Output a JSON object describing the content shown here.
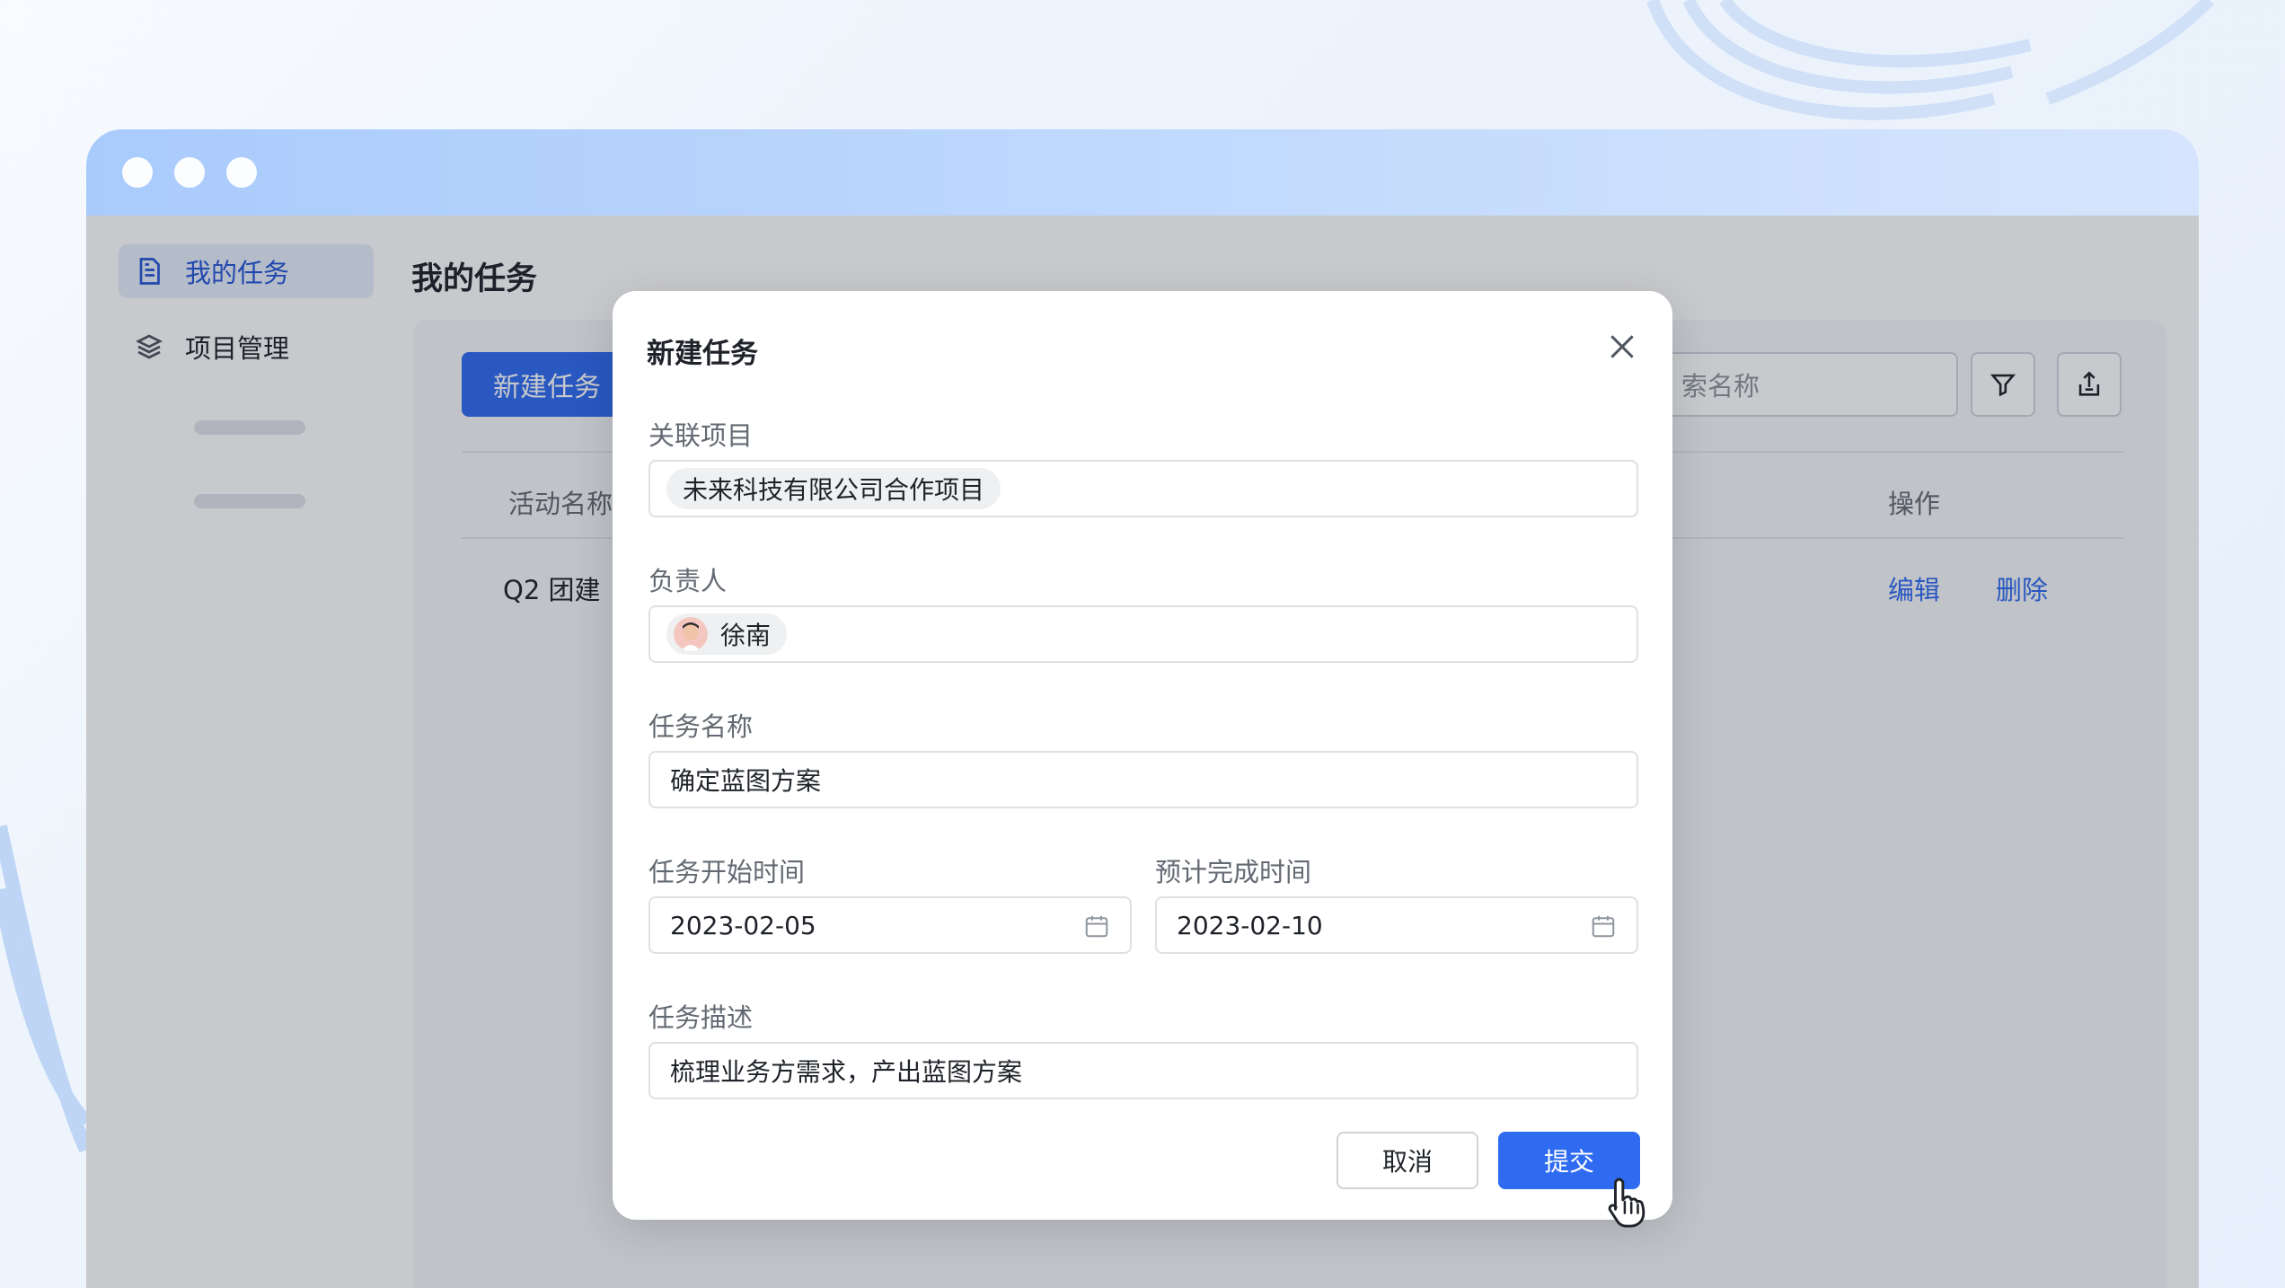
{
  "window": {
    "traffic_lights": [
      "dot",
      "dot",
      "dot"
    ]
  },
  "sidebar": {
    "items": [
      {
        "label": "我的任务",
        "icon": "document-icon",
        "active": true
      },
      {
        "label": "项目管理",
        "icon": "layers-icon",
        "active": false
      }
    ]
  },
  "page": {
    "title": "我的任务"
  },
  "toolbar": {
    "new_task_label": "新建任务",
    "search_placeholder": "搜索名称",
    "search_visible_text": "索名称",
    "filter_icon": "filter-icon",
    "export_icon": "export-icon"
  },
  "table": {
    "headers": {
      "name": "活动名称",
      "actions": "操作"
    },
    "rows": [
      {
        "name": "Q2 团建",
        "edit": "编辑",
        "delete": "删除"
      }
    ]
  },
  "modal": {
    "title": "新建任务",
    "close_icon": "close-icon",
    "project": {
      "label": "关联项目",
      "value": "未来科技有限公司合作项目"
    },
    "owner": {
      "label": "负责人",
      "value": "徐南"
    },
    "task_name": {
      "label": "任务名称",
      "value": "确定蓝图方案"
    },
    "start_date": {
      "label": "任务开始时间",
      "value": "2023-02-05"
    },
    "end_date": {
      "label": "预计完成时间",
      "value": "2023-02-10"
    },
    "description": {
      "label": "任务描述",
      "value": "梳理业务方需求，产出蓝图方案"
    },
    "cancel_label": "取消",
    "submit_label": "提交"
  },
  "colors": {
    "accent": "#2f6bf1",
    "link": "#2f6bf1"
  }
}
